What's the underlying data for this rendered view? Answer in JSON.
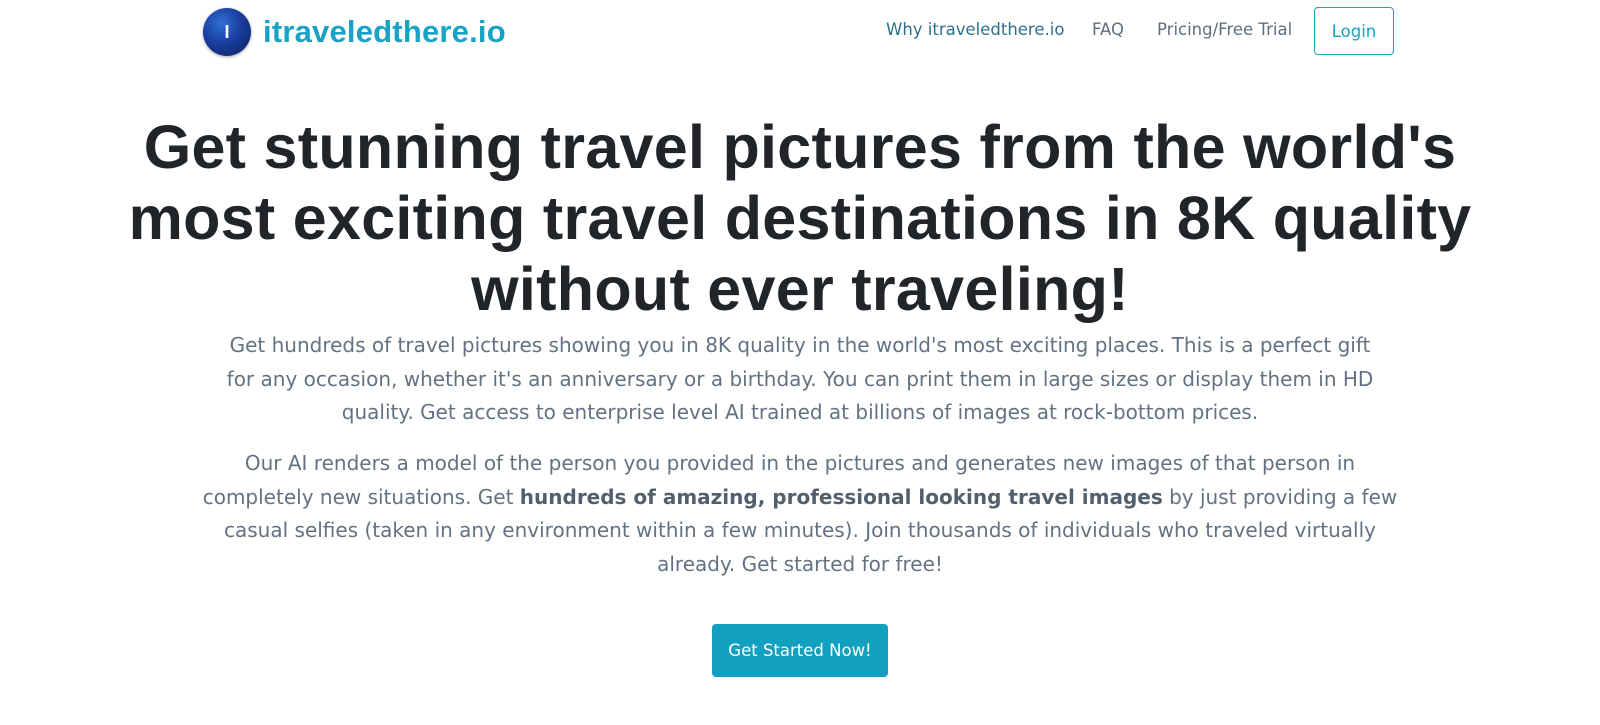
{
  "brand": {
    "logo_letter": "I",
    "name": "itraveledthere.io",
    "accent_color": "#17a2c6"
  },
  "nav": {
    "why": "Why itraveledthere.io",
    "faq": "FAQ",
    "pricing": "Pricing/Free Trial",
    "login": "Login"
  },
  "hero": {
    "title_lines": [
      "Get stunning travel pictures from the world's",
      "most exciting travel destinations in 8K quality",
      "without ever traveling!"
    ],
    "paragraph1_lines": [
      "Get hundreds of travel pictures showing you in 8K quality in the world's most exciting places. This is a perfect gift",
      "for any occasion, whether it's an anniversary or a birthday. You can print them in large sizes or display them in HD",
      "quality. Get access to enterprise level AI trained at billions of images at rock-bottom prices."
    ],
    "paragraph2": {
      "line1": "Our AI renders a model of the person you provided in the pictures and generates new images of that person in",
      "line2_before": "completely new situations. Get ",
      "line2_bold": "hundreds of amazing, professional looking travel images",
      "line2_after": " by just providing a few",
      "line3": "casual selfies (taken in any environment within a few minutes). Join thousands of individuals who traveled virtually",
      "line4": "already. Get started for free!"
    },
    "cta_label": "Get Started Now!",
    "cta_color": "#11a0c0"
  }
}
